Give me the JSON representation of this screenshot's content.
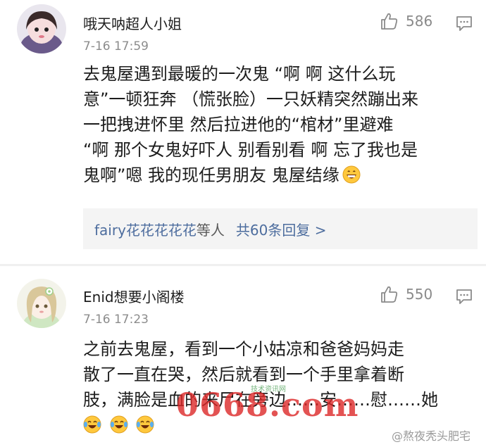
{
  "comments": [
    {
      "username": "哦天呐超人小姐",
      "time": "7-16 17:59",
      "likes": "586",
      "lines": [
        "去鬼屋遇到最暖的一次鬼 “啊 啊 这什么玩",
        "意”一顿狂奔 （慌张脸）一只妖精突然蹦出来",
        "一把拽进怀里 然后拉进他的“棺材”里避难",
        "“啊 那个女鬼好吓人 别看别看 啊 忘了我也是",
        "鬼啊”嗯 我的现任男朋友 鬼屋结缘"
      ],
      "replies": {
        "users": "fairy花花花花花",
        "etc": "等人",
        "count": "共60条回复 >"
      }
    },
    {
      "username": "Enid想要小阁楼",
      "time": "7-16 17:23",
      "likes": "550",
      "lines": [
        "之前去鬼屋，看到一个小姑凉和爸爸妈妈走",
        "散了一直在哭，然后就看到一个手里拿着断",
        "肢，满脸是血的来尸在旁边……安……慰……她"
      ]
    }
  ],
  "watermark": {
    "main": "0668.com",
    "small": "技术资讯网"
  },
  "weibo_mark": "@熬夜秃头肥宅",
  "icons": {
    "like": "thumbs-up-icon",
    "reply": "comment-icon",
    "emoji_grin": "grinning-emoji",
    "emoji_laugh": "tears-of-joy-emoji"
  },
  "colors": {
    "link": "#4d6d9e",
    "meta": "#8c8c8c",
    "reply_bg": "#f4f4f4"
  }
}
